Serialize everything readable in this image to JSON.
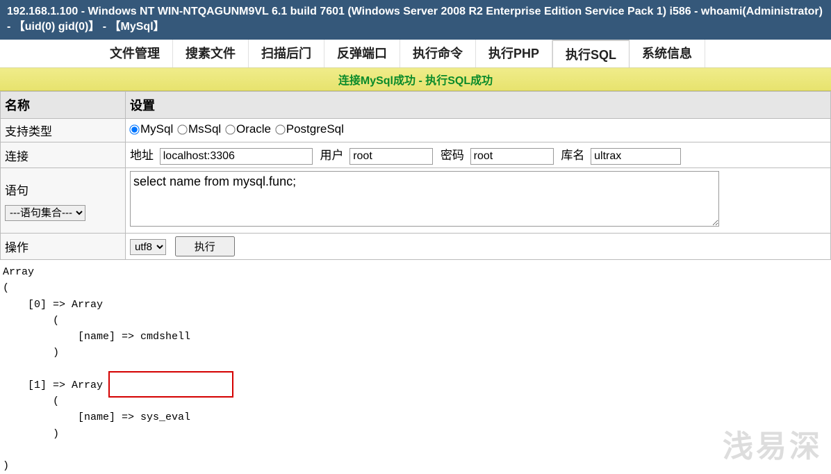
{
  "header": {
    "title": "192.168.1.100 - Windows NT WIN-NTQAGUNM9VL 6.1 build 7601 (Windows Server 2008 R2 Enterprise Edition Service Pack 1) i586 - whoami(Administrator) - 【uid(0) gid(0)】 - 【MySql】"
  },
  "tabs": {
    "items": [
      {
        "label": "文件管理",
        "active": false
      },
      {
        "label": "搜素文件",
        "active": false
      },
      {
        "label": "扫描后门",
        "active": false
      },
      {
        "label": "反弹端口",
        "active": false
      },
      {
        "label": "执行命令",
        "active": false
      },
      {
        "label": "执行PHP",
        "active": false
      },
      {
        "label": "执行SQL",
        "active": true
      },
      {
        "label": "系统信息",
        "active": false
      }
    ]
  },
  "status": {
    "message": "连接MySql成功 - 执行SQL成功"
  },
  "form": {
    "header_name": "名称",
    "header_setting": "设置",
    "row_type_label": "支持类型",
    "db_types": [
      {
        "label": "MySql",
        "checked": true
      },
      {
        "label": "MsSql",
        "checked": false
      },
      {
        "label": "Oracle",
        "checked": false
      },
      {
        "label": "PostgreSql",
        "checked": false
      }
    ],
    "row_conn_label": "连接",
    "conn": {
      "addr_label": "地址",
      "addr_value": "localhost:3306",
      "user_label": "用户",
      "user_value": "root",
      "pass_label": "密码",
      "pass_value": "root",
      "db_label": "库名",
      "db_value": "ultrax"
    },
    "row_stmt_label": "语句",
    "stmt_value": "select name from mysql.func;",
    "stmt_select_placeholder": "---语句集合---",
    "row_op_label": "操作",
    "charset_value": "utf8",
    "exec_label": "执行"
  },
  "result": {
    "text": "Array\n(\n    [0] => Array\n        (\n            [name] => cmdshell\n        )\n\n    [1] => Array\n        (\n            [name] => sys_eval\n        )\n\n)"
  },
  "watermark": "浅易深"
}
